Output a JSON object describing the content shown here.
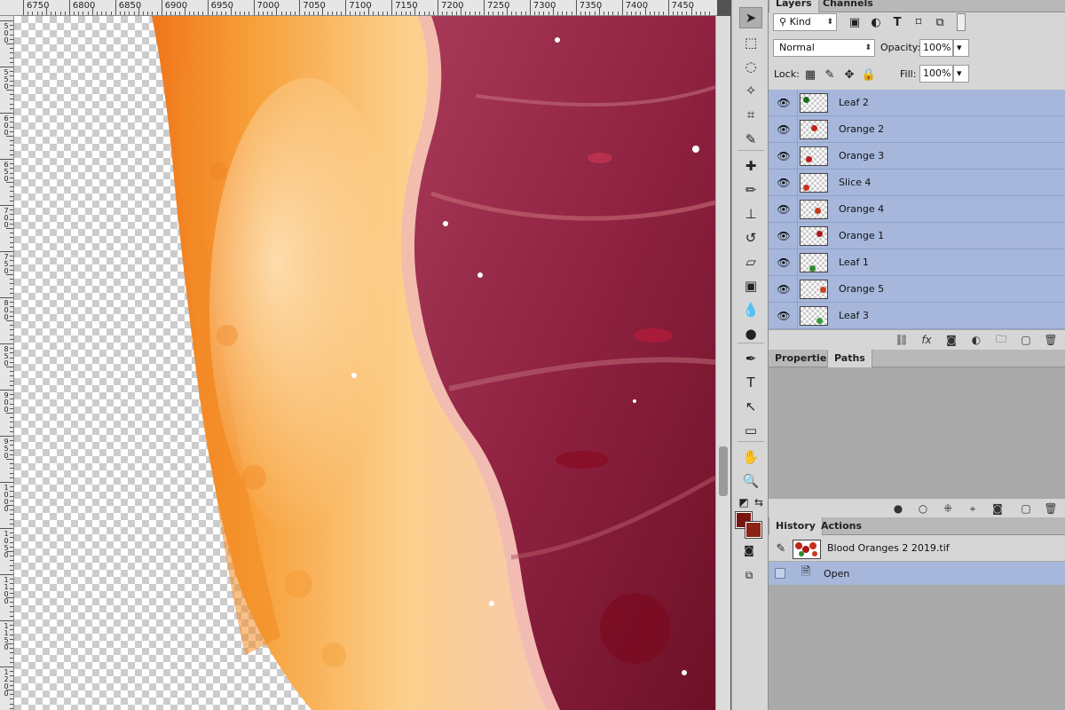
{
  "ruler_top": {
    "labels": [
      "6750",
      "6800",
      "6850",
      "6900",
      "6950",
      "7000",
      "7050",
      "7100",
      "7150",
      "7200",
      "7250",
      "7300",
      "7350",
      "7400",
      "7450"
    ]
  },
  "ruler_left": {
    "labels": [
      "500",
      "550",
      "600",
      "650",
      "700",
      "750",
      "800",
      "850",
      "900",
      "950",
      "1000",
      "1050",
      "1100",
      "1150",
      "1200"
    ]
  },
  "colors": {
    "foreground": "#7a1410",
    "background": "#8a2216",
    "layer_selected": "#a7b7db"
  },
  "tools": [
    {
      "icon": "move-tool-icon",
      "glyph": "➤"
    },
    {
      "icon": "marquee-tool-icon",
      "glyph": "⬚"
    },
    {
      "icon": "lasso-tool-icon",
      "glyph": "◌"
    },
    {
      "icon": "quick-select-tool-icon",
      "glyph": "✧"
    },
    {
      "icon": "crop-tool-icon",
      "glyph": "⌗"
    },
    {
      "icon": "eyedropper-tool-icon",
      "glyph": "✎"
    },
    {
      "icon": "healing-brush-tool-icon",
      "glyph": "✚"
    },
    {
      "icon": "brush-tool-icon",
      "glyph": "✏"
    },
    {
      "icon": "clone-stamp-tool-icon",
      "glyph": "⊥"
    },
    {
      "icon": "history-brush-tool-icon",
      "glyph": "↺"
    },
    {
      "icon": "eraser-tool-icon",
      "glyph": "▱"
    },
    {
      "icon": "gradient-tool-icon",
      "glyph": "▣"
    },
    {
      "icon": "blur-tool-icon",
      "glyph": "💧"
    },
    {
      "icon": "dodge-tool-icon",
      "glyph": "●"
    },
    {
      "icon": "pen-tool-icon",
      "glyph": "✒"
    },
    {
      "icon": "type-tool-icon",
      "glyph": "T"
    },
    {
      "icon": "path-selection-tool-icon",
      "glyph": "↖"
    },
    {
      "icon": "rectangle-tool-icon",
      "glyph": "▭"
    },
    {
      "icon": "hand-tool-icon",
      "glyph": "✋"
    },
    {
      "icon": "zoom-tool-icon",
      "glyph": "🔍"
    }
  ],
  "layers_panel": {
    "tabs": [
      "Layers",
      "Channels"
    ],
    "filter_kind": "Kind",
    "blend_mode": "Normal",
    "opacity_label": "Opacity:",
    "opacity_value": "100%",
    "lock_label": "Lock:",
    "fill_label": "Fill:",
    "fill_value": "100%",
    "layers": [
      {
        "name": "Leaf 2",
        "thumb_color": "#1f6a1f"
      },
      {
        "name": "Orange 2",
        "thumb_color": "#c0241a"
      },
      {
        "name": "Orange 3",
        "thumb_color": "#b81f1a"
      },
      {
        "name": "Slice 4",
        "thumb_color": "#c8301e"
      },
      {
        "name": "Orange 4",
        "thumb_color": "#c83a1c"
      },
      {
        "name": "Orange 1",
        "thumb_color": "#b01818"
      },
      {
        "name": "Leaf 1",
        "thumb_color": "#2e8a2e"
      },
      {
        "name": "Orange 5",
        "thumb_color": "#c8401e"
      },
      {
        "name": "Leaf 3",
        "thumb_color": "#3a9a3a"
      }
    ]
  },
  "properties_panel": {
    "tabs": [
      "Properties",
      "Paths"
    ]
  },
  "history_panel": {
    "tabs": [
      "History",
      "Actions"
    ],
    "snapshot_name": "Blood Oranges 2 2019.tif",
    "states": [
      "Open"
    ]
  }
}
